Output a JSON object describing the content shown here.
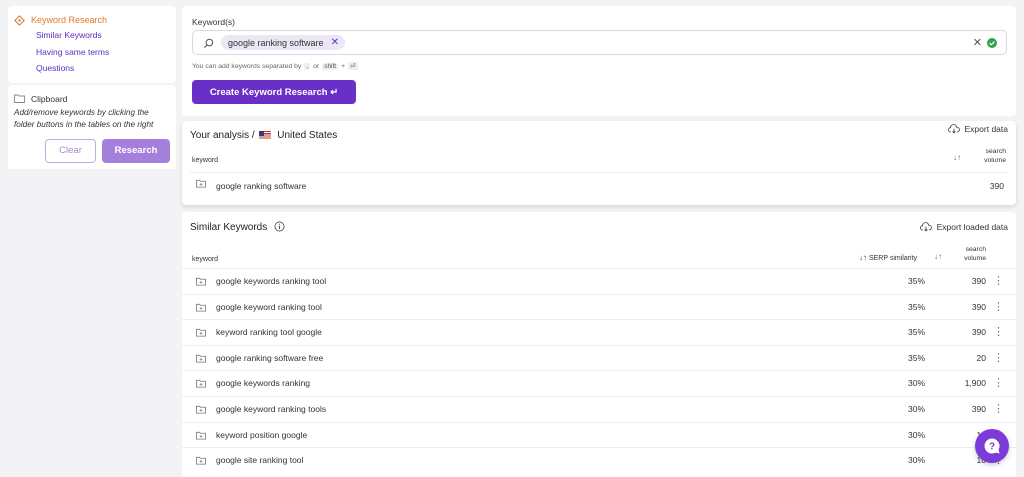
{
  "sidebar": {
    "section_title": "Keyword Research",
    "links": [
      "Similar Keywords",
      "Having same terms",
      "Questions"
    ],
    "clipboard_title": "Clipboard",
    "clipboard_desc": "Add/remove keywords by clicking the folder buttons in the tables on the right",
    "clear_label": "Clear",
    "research_label": "Research"
  },
  "input": {
    "label": "Keyword(s)",
    "chip": "google ranking software",
    "hint_prefix": "You can add keywords separated by",
    "hint_key1": ",",
    "hint_or": "or",
    "hint_key2": "shift",
    "hint_plus": "+",
    "hint_key3": "⏎",
    "create_label": "Create Keyword Research ↵"
  },
  "analysis": {
    "title": "Your analysis",
    "separator": "/",
    "country": "United States",
    "export_label": "Export data",
    "col_keyword": "keyword",
    "col_volume": "search volume",
    "rows": [
      {
        "keyword": "google ranking software",
        "volume": "390"
      }
    ]
  },
  "similar": {
    "title": "Similar Keywords",
    "export_label": "Export loaded data",
    "col_keyword": "keyword",
    "col_similarity": "SERP similarity",
    "col_volume": "search volume",
    "rows": [
      {
        "keyword": "google keywords ranking tool",
        "sim": "35%",
        "volume": "390"
      },
      {
        "keyword": "google keyword ranking tool",
        "sim": "35%",
        "volume": "390"
      },
      {
        "keyword": "keyword ranking tool google",
        "sim": "35%",
        "volume": "390"
      },
      {
        "keyword": "google ranking software free",
        "sim": "35%",
        "volume": "20"
      },
      {
        "keyword": "google keywords ranking",
        "sim": "30%",
        "volume": "1,900"
      },
      {
        "keyword": "google keyword ranking tools",
        "sim": "30%",
        "volume": "390"
      },
      {
        "keyword": "keyword position google",
        "sim": "30%",
        "volume": "14"
      },
      {
        "keyword": "google site ranking tool",
        "sim": "30%",
        "volume": "10"
      }
    ]
  },
  "colors": {
    "accent": "#6a2fc7",
    "orange": "#e07a2e",
    "link": "#5b2fc0"
  }
}
